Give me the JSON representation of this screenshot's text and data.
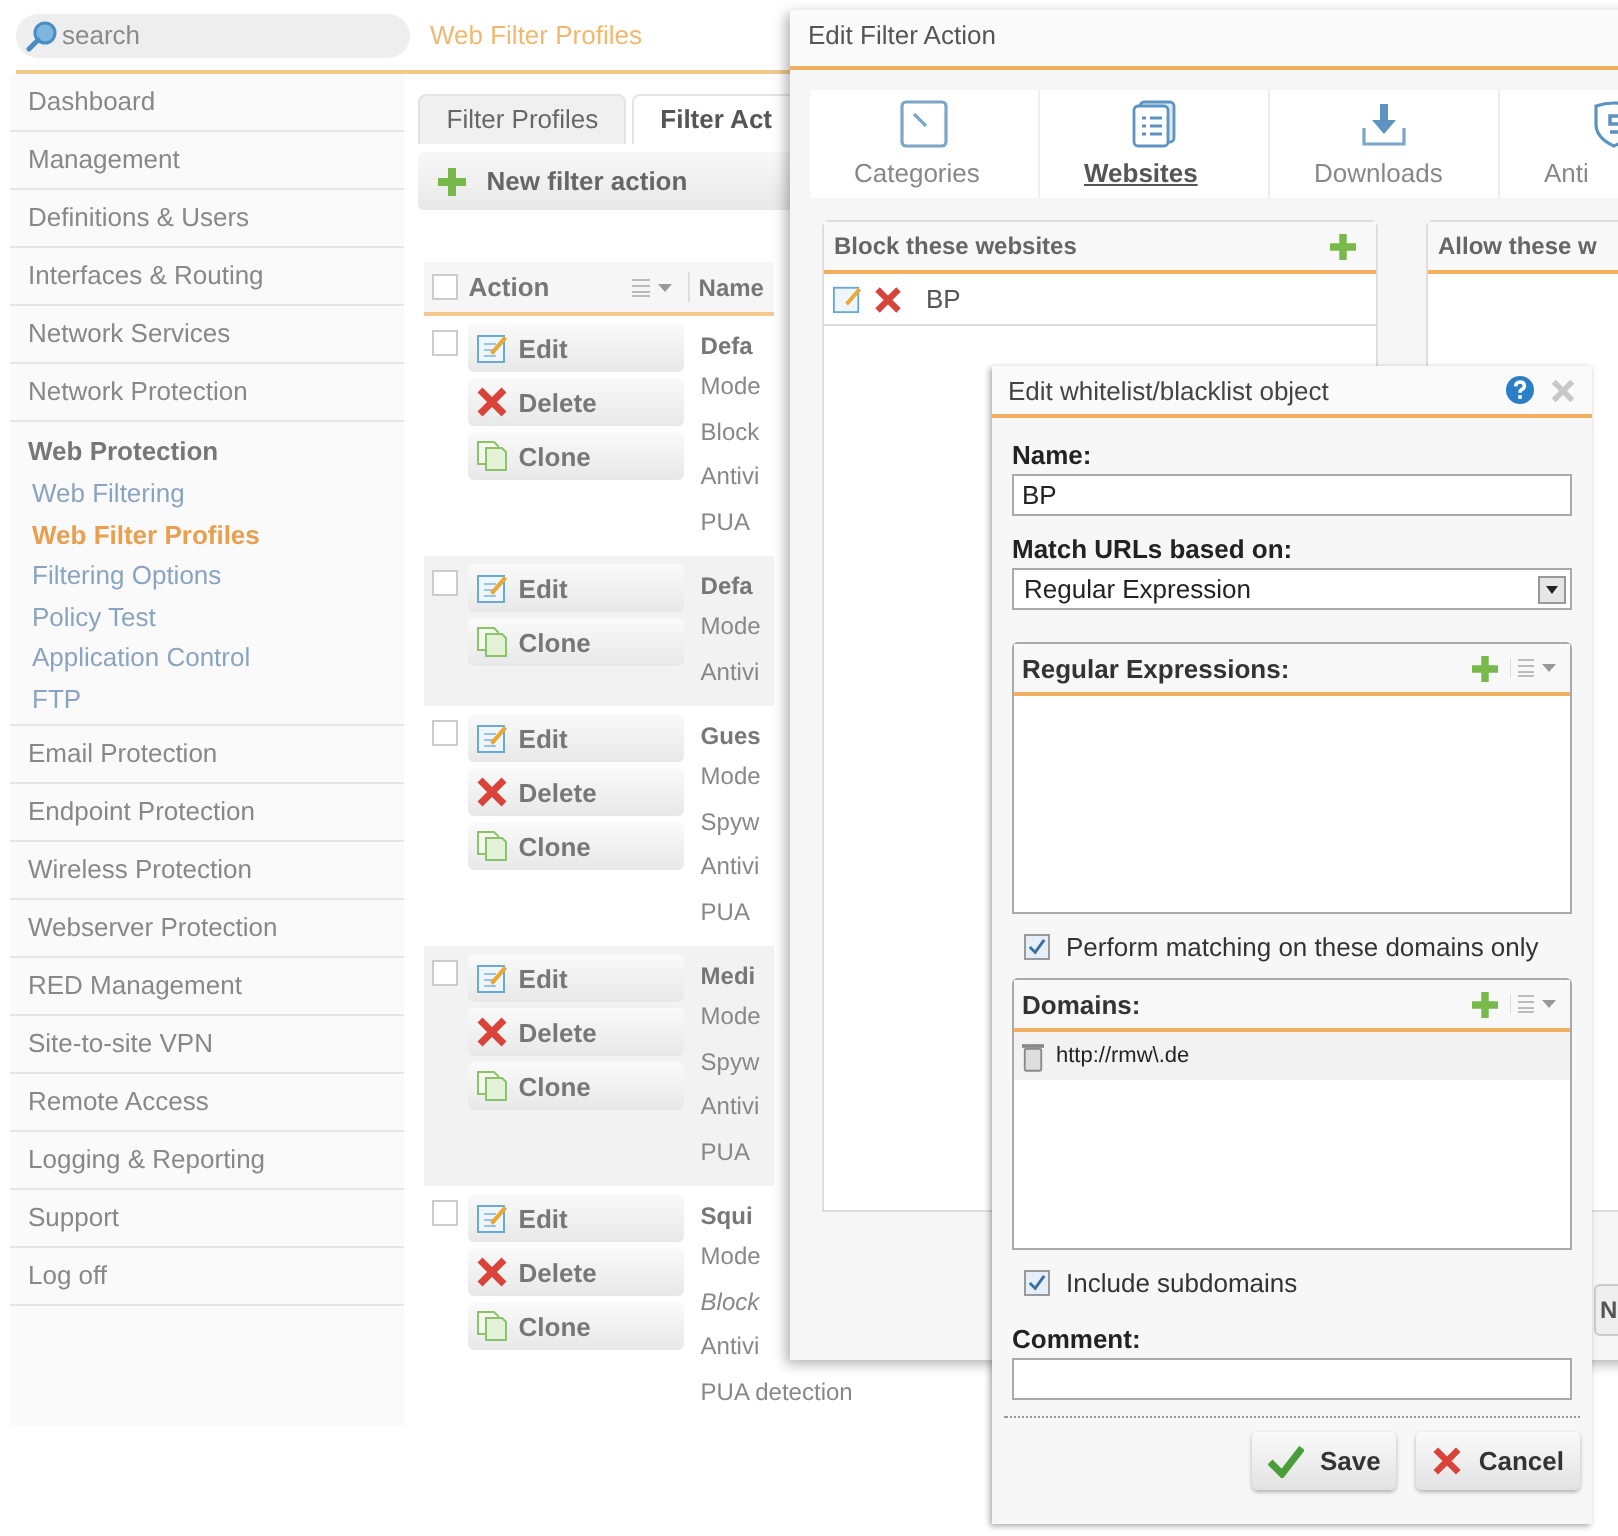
{
  "sidebar": {
    "search": {
      "placeholder": "search"
    },
    "items": [
      {
        "label": "Dashboard",
        "expanded": false
      },
      {
        "label": "Management",
        "expanded": false
      },
      {
        "label": "Definitions & Users",
        "expanded": false
      },
      {
        "label": "Interfaces & Routing",
        "expanded": false
      },
      {
        "label": "Network Services",
        "expanded": false
      },
      {
        "label": "Network Protection",
        "expanded": false
      },
      {
        "label": "Web Protection",
        "expanded": true,
        "children": [
          {
            "label": "Web Filtering",
            "selected": false
          },
          {
            "label": "Web Filter Profiles",
            "selected": true
          },
          {
            "label": "Filtering Options",
            "selected": false
          },
          {
            "label": "Policy Test",
            "selected": false
          },
          {
            "label": "Application Control",
            "selected": false
          },
          {
            "label": "FTP",
            "selected": false
          }
        ]
      },
      {
        "label": "Email Protection",
        "expanded": false
      },
      {
        "label": "Endpoint Protection",
        "expanded": false
      },
      {
        "label": "Wireless Protection",
        "expanded": false
      },
      {
        "label": "Webserver Protection",
        "expanded": false
      },
      {
        "label": "RED Management",
        "expanded": false
      },
      {
        "label": "Site-to-site VPN",
        "expanded": false
      },
      {
        "label": "Remote Access",
        "expanded": false
      },
      {
        "label": "Logging & Reporting",
        "expanded": false
      },
      {
        "label": "Support",
        "expanded": false
      },
      {
        "label": "Log off",
        "expanded": false
      }
    ]
  },
  "page": {
    "title": "Web Filter Profiles",
    "tabs": [
      {
        "label": "Filter Profiles",
        "selected": false
      },
      {
        "label": "Filter Act",
        "selected": true
      }
    ],
    "new_button": "New filter action",
    "table": {
      "columns": [
        "Action",
        "Name"
      ],
      "select_all_checked": false,
      "rows": [
        {
          "checked": false,
          "buttons": [
            {
              "label": "Edit",
              "kind": "edit"
            },
            {
              "label": "Delete",
              "kind": "delete"
            },
            {
              "label": "Clone",
              "kind": "clone"
            }
          ],
          "name": "Defa",
          "details": [
            {
              "text": "Mode",
              "italic": false
            },
            {
              "text": "Block",
              "italic": false
            },
            {
              "text": "Antivi",
              "italic": false
            },
            {
              "text": "PUA",
              "italic": false
            }
          ]
        },
        {
          "checked": false,
          "buttons": [
            {
              "label": "Edit",
              "kind": "edit"
            },
            {
              "label": "Clone",
              "kind": "clone"
            }
          ],
          "name": "Defa",
          "details": [
            {
              "text": "Mode",
              "italic": false
            },
            {
              "text": "Antivi",
              "italic": false
            }
          ]
        },
        {
          "checked": false,
          "buttons": [
            {
              "label": "Edit",
              "kind": "edit"
            },
            {
              "label": "Delete",
              "kind": "delete"
            },
            {
              "label": "Clone",
              "kind": "clone"
            }
          ],
          "name": "Gues",
          "details": [
            {
              "text": "Mode",
              "italic": false
            },
            {
              "text": "Spyw",
              "italic": false
            },
            {
              "text": "Antivi",
              "italic": false
            },
            {
              "text": "PUA",
              "italic": false
            }
          ]
        },
        {
          "checked": false,
          "buttons": [
            {
              "label": "Edit",
              "kind": "edit"
            },
            {
              "label": "Delete",
              "kind": "delete"
            },
            {
              "label": "Clone",
              "kind": "clone"
            }
          ],
          "name": "Medi",
          "details": [
            {
              "text": "Mode",
              "italic": false
            },
            {
              "text": "Spyw",
              "italic": false
            },
            {
              "text": "Antivi",
              "italic": false
            },
            {
              "text": "PUA",
              "italic": false
            }
          ]
        },
        {
          "checked": false,
          "buttons": [
            {
              "label": "Edit",
              "kind": "edit"
            },
            {
              "label": "Delete",
              "kind": "delete"
            },
            {
              "label": "Clone",
              "kind": "clone"
            }
          ],
          "name": "Squi",
          "details": [
            {
              "text": "Mode",
              "italic": false
            },
            {
              "text": "Block",
              "italic": true
            },
            {
              "text": "Antivi",
              "italic": false
            },
            {
              "text": "PUA detection",
              "italic": false
            }
          ]
        }
      ]
    }
  },
  "edit_filter_action": {
    "title": "Edit Filter Action",
    "tabs": [
      {
        "label": "Categories",
        "kind": "categories",
        "selected": false
      },
      {
        "label": "Websites",
        "kind": "websites",
        "selected": true
      },
      {
        "label": "Downloads",
        "kind": "downloads",
        "selected": false
      },
      {
        "label": "Anti",
        "kind": "antivirus",
        "selected": false
      }
    ],
    "block_panel": {
      "title": "Block these websites",
      "items": [
        "BP"
      ]
    },
    "allow_panel": {
      "title": "Allow these w"
    },
    "footer_button": "N"
  },
  "object_dialog": {
    "title": "Edit whitelist/blacklist object",
    "name_label": "Name:",
    "name_value": "BP",
    "match_label": "Match URLs based on:",
    "match_value": "Regular Expression",
    "regex_list": {
      "title": "Regular Expressions:"
    },
    "domains_only": {
      "label": "Perform matching on these domains only",
      "checked": true
    },
    "domains": {
      "title": "Domains:",
      "items": [
        "http://rmw\\.de"
      ]
    },
    "subdomains": {
      "label": "Include subdomains",
      "checked": true
    },
    "comment_label": "Comment:",
    "buttons": [
      {
        "label": "Save",
        "kind": "save"
      },
      {
        "label": "Cancel",
        "kind": "cancel"
      }
    ]
  }
}
